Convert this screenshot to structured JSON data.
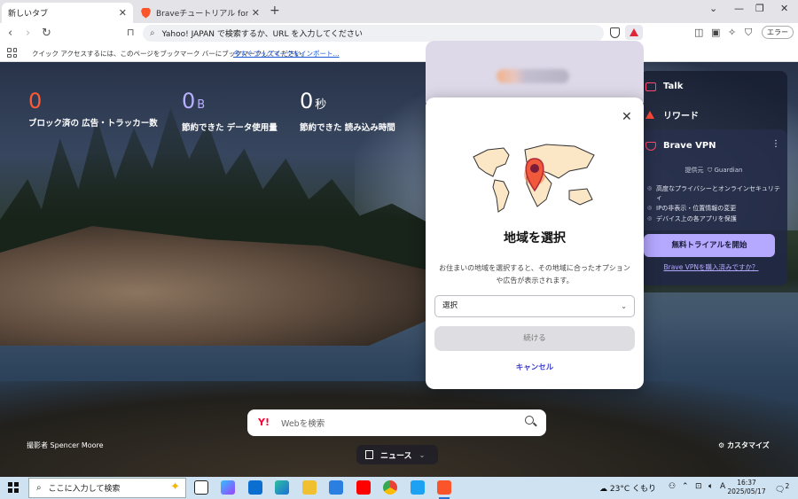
{
  "tabs": [
    {
      "title": "新しいタブ",
      "close": "✕",
      "active": true
    },
    {
      "title": "Braveチュートリアル for Desktop | Brave",
      "close": "✕",
      "active": false
    }
  ],
  "toolbar": {
    "omnibox_placeholder": "Yahoo! JAPAN で検索するか、URL を入力してください",
    "error_label": "エラー"
  },
  "bookmarks_bar": {
    "message": "クイック アクセスするには、このページをブックマーク バーにブックマークしてください。",
    "import_link": "今すぐブックマークをインポート..."
  },
  "stats": [
    {
      "value": "0",
      "unit": "",
      "label": "ブロック済の 広告・トラッカー数",
      "color": "#ff5a36"
    },
    {
      "value": "0",
      "unit": "B",
      "label": "節約できた データ使用量",
      "color": "#b8b0ff"
    },
    {
      "value": "0",
      "unit": "秒",
      "label": "節約できた 読み込み時間",
      "color": "#ffffff"
    }
  ],
  "widgets": {
    "talk": "Talk",
    "rewards": "リワード",
    "vpn": {
      "title": "Brave VPN",
      "provided_by": "提供元",
      "provider": "Guardian",
      "features": [
        "高度なプライバシーとオンラインセキュリティ",
        "IPの非表示・位置情報の変更",
        "デバイス上の各アプリを保護"
      ],
      "trial_button": "無料トライアルを開始",
      "purchased_link": "Brave VPNを購入済みですか？"
    }
  },
  "dialog": {
    "title": "地域を選択",
    "description": "お住まいの地域を選択すると、その地域に合ったオプションや広告が表示されます。",
    "select_value": "選択",
    "continue": "続ける",
    "cancel": "キャンセル"
  },
  "search": {
    "placeholder": "Webを検索"
  },
  "credit": "撮影者 Spencer Moore",
  "news": "ニュース",
  "customize": "カスタマイズ",
  "taskbar": {
    "search_placeholder": "ここに入力して検索",
    "weather": "23°C くもり",
    "ime": "A",
    "time": "16:37",
    "date": "2025/05/17",
    "notification_count": "2"
  }
}
